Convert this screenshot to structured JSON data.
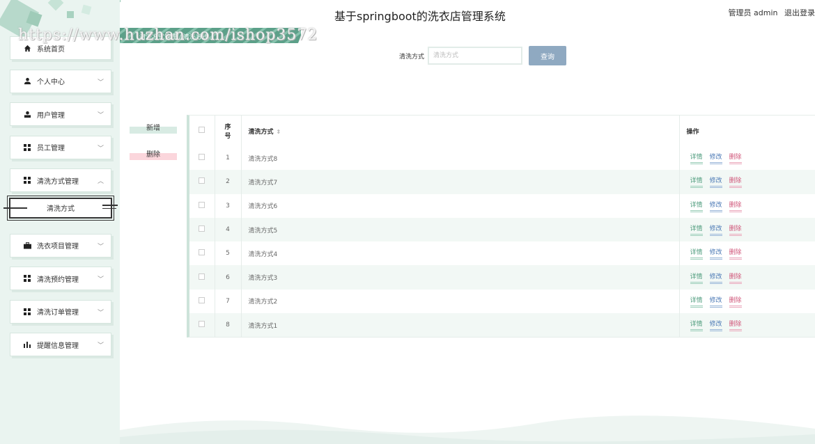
{
  "header": {
    "title": "基于springboot的洗衣店管理系统",
    "user_label": "管理员 admin",
    "logout": "退出登录",
    "breadcrumb": "清洗方式管理 / 清洗方式",
    "watermark": "https://www.huzhan.com/ishop3572"
  },
  "sidebar": {
    "items": [
      {
        "label": "系统首页",
        "icon": "home-icon"
      },
      {
        "label": "个人中心",
        "icon": "user-icon"
      },
      {
        "label": "用户管理",
        "icon": "user-manage-icon"
      },
      {
        "label": "员工管理",
        "icon": "grid-icon"
      },
      {
        "label": "清洗方式管理",
        "icon": "grid-icon"
      },
      {
        "label": "洗衣项目管理",
        "icon": "briefcase-icon"
      },
      {
        "label": "清洗预约管理",
        "icon": "grid-icon"
      },
      {
        "label": "清洗订单管理",
        "icon": "grid-icon"
      },
      {
        "label": "提醒信息管理",
        "icon": "chart-icon"
      }
    ],
    "submenu_active": "清洗方式"
  },
  "search": {
    "label": "清洗方式",
    "placeholder": "清洗方式",
    "button": "查询"
  },
  "actions": {
    "add": "新增",
    "delete": "删除"
  },
  "table": {
    "headers": {
      "index": "序号",
      "method": "清洗方式",
      "operation": "操作"
    },
    "ops": {
      "detail": "详情",
      "edit": "修改",
      "delete": "删除"
    },
    "rows": [
      {
        "idx": "1",
        "method": "清洗方式8"
      },
      {
        "idx": "2",
        "method": "清洗方式7"
      },
      {
        "idx": "3",
        "method": "清洗方式6"
      },
      {
        "idx": "4",
        "method": "清洗方式5"
      },
      {
        "idx": "5",
        "method": "清洗方式4"
      },
      {
        "idx": "6",
        "method": "清洗方式3"
      },
      {
        "idx": "7",
        "method": "清洗方式2"
      },
      {
        "idx": "8",
        "method": "清洗方式1"
      }
    ]
  },
  "colors": {
    "accent": "#3f8f74",
    "sidebar_bg": "#eaf4f0",
    "query_btn": "#8fa9c1"
  }
}
